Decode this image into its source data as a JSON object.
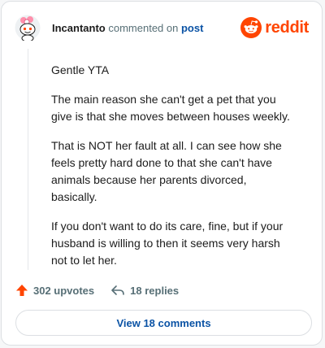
{
  "header": {
    "username": "Incantanto",
    "commented_text": "commented on",
    "post_link": "post",
    "brand_wordmark": "reddit",
    "brand_color": "#ff4500"
  },
  "comment": {
    "paragraphs": [
      "Gentle YTA",
      "The main reason she can't get a pet that you give is that she moves between houses weekly.",
      "That is NOT her fault at all. I can see how she feels pretty hard done to that she can't have animals because her parents divorced, basically.",
      "If you don't want to do its care, fine, but if your husband is willing to then it seems very harsh not to let her."
    ]
  },
  "actions": {
    "upvotes_label": "302 upvotes",
    "replies_label": "18 replies",
    "upvote_icon": "upvote-arrow-icon",
    "reply_icon": "reply-arrow-icon",
    "upvote_color": "#ff4500"
  },
  "footer": {
    "view_comments_label": "View 18 comments"
  }
}
